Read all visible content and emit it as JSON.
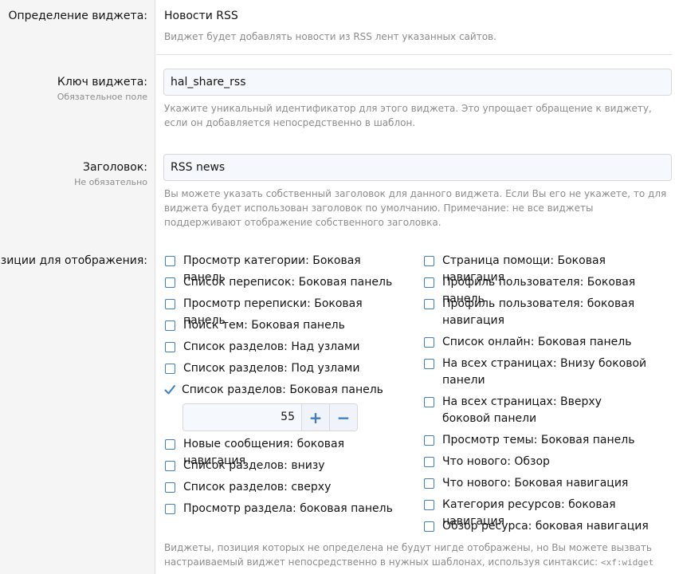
{
  "definition": {
    "label": "Определение виджета:",
    "value": "Новости RSS",
    "hint": "Виджет будет добавлять новости из RSS лент указанных сайтов."
  },
  "key": {
    "label": "Ключ виджета:",
    "sublabel": "Обязательное поле",
    "value": "hal_share_rss",
    "hint": "Укажите уникальный идентификатор для этого виджета. Это упрощает обращение к виджету, если он добавляется непосредственно в шаблон."
  },
  "title": {
    "label": "Заголовок:",
    "sublabel": "Не обязательно",
    "value": "RSS news",
    "hint": "Вы можете указать собственный заголовок для данного виджета. Если Вы его не укажете, то для виджета будет использован заголовок по умолчанию. Примечание: не все виджеты поддерживают отображение собственного заголовка."
  },
  "positions": {
    "label": "Позиции для отображения:",
    "left": [
      {
        "label": "Просмотр категории: Боковая панель",
        "checked": false
      },
      {
        "label": "Список переписок: Боковая панель",
        "checked": false
      },
      {
        "label": "Просмотр переписки: Боковая панель",
        "checked": false
      },
      {
        "label": "Поиск тем: Боковая панель",
        "checked": false
      },
      {
        "label": "Список разделов: Над узлами",
        "checked": false
      },
      {
        "label": "Список разделов: Под узлами",
        "checked": false
      },
      {
        "label": "Список разделов: Боковая панель",
        "checked": true
      },
      {
        "label": "Новые сообщения: боковая навигация",
        "checked": false
      },
      {
        "label": "Список разделов: внизу",
        "checked": false
      },
      {
        "label": "Список разделов: сверху",
        "checked": false
      },
      {
        "label": "Просмотр раздела: боковая панель",
        "checked": false
      }
    ],
    "right": [
      {
        "label": "Страница помощи: Боковая навигация",
        "checked": false
      },
      {
        "label": "Профиль пользователя: Боковая панель",
        "checked": false
      },
      {
        "label": "Профиль пользователя: боковая навигация",
        "checked": false
      },
      {
        "label": "Список онлайн: Боковая панель",
        "checked": false
      },
      {
        "label": "На всех страницах: Внизу боковой панели",
        "checked": false
      },
      {
        "label": "На всех страницах: Вверху боковой панели",
        "checked": false
      },
      {
        "label": "Просмотр темы: Боковая панель",
        "checked": false
      },
      {
        "label": "Что нового: Обзор",
        "checked": false
      },
      {
        "label": "Что нового: Боковая навигация",
        "checked": false
      },
      {
        "label": "Категория ресурсов: боковая навигация",
        "checked": false
      },
      {
        "label": "Обзор ресурса: боковая навигация",
        "checked": false
      }
    ],
    "order_value": "55",
    "hint_text": "Виджеты, позиция которых не определена не будут нигде отображены, но Вы можете вызвать настраиваемый виджет непосредственно в нужных шаблонах, используя синтаксис: ",
    "hint_code": "<xf:widget"
  },
  "colors": {
    "accent": "#3d7fc1",
    "label_column_bg": "#f5f5f5",
    "input_bg": "#f5f8fc",
    "hint_text": "#8c8c8c"
  }
}
